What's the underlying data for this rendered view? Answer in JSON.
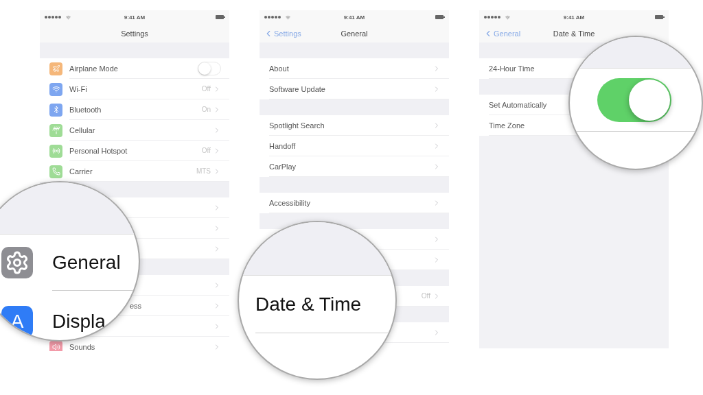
{
  "panels": [
    {
      "status": {
        "time": "9:41 AM"
      },
      "nav": {
        "title": "Settings"
      },
      "groups": [
        [
          {
            "label": "Airplane Mode",
            "kind": "toggle",
            "on": false
          },
          {
            "label": "Wi-Fi",
            "kind": "link",
            "value": "Off"
          },
          {
            "label": "Bluetooth",
            "kind": "link",
            "value": "On"
          },
          {
            "label": "Cellular",
            "kind": "link"
          },
          {
            "label": "Personal Hotspot",
            "kind": "link",
            "value": "Off"
          },
          {
            "label": "Carrier",
            "kind": "link",
            "value": "MTS"
          }
        ],
        [
          {
            "kind": "link"
          },
          {
            "kind": "link"
          },
          {
            "kind": "link"
          }
        ],
        [
          {
            "kind": "link"
          },
          {
            "kind": "link",
            "label": "ess",
            "clipped": true
          },
          {
            "kind": "link"
          },
          {
            "label": "Sounds",
            "kind": "link"
          }
        ]
      ]
    },
    {
      "status": {
        "time": "9:41 AM"
      },
      "nav": {
        "back": "Settings",
        "title": "General"
      },
      "groups": [
        [
          {
            "label": "About",
            "kind": "link"
          },
          {
            "label": "Software Update",
            "kind": "link"
          }
        ],
        [
          {
            "label": "Spotlight Search",
            "kind": "link"
          },
          {
            "label": "Handoff",
            "kind": "link"
          },
          {
            "label": "CarPlay",
            "kind": "link"
          }
        ],
        [
          {
            "label": "Accessibility",
            "kind": "link"
          }
        ],
        [
          {
            "kind": "link"
          },
          {
            "kind": "link"
          }
        ],
        [
          {
            "kind": "link",
            "value": "Off"
          }
        ],
        [
          {
            "kind": "link"
          }
        ]
      ]
    },
    {
      "status": {
        "time": "9:41 AM"
      },
      "nav": {
        "back": "General",
        "title": "Date & Time"
      },
      "groups": [
        [
          {
            "label": "24-Hour Time",
            "kind": "plain"
          }
        ],
        [
          {
            "label": "Set Automatically",
            "kind": "plain"
          },
          {
            "label": "Time Zone",
            "kind": "plain"
          }
        ]
      ]
    }
  ],
  "magnifiers": [
    {
      "kind": "rows",
      "rows": [
        {
          "label": "General"
        },
        {
          "label": "Displa",
          "icon_text": "A"
        }
      ]
    },
    {
      "kind": "row",
      "label": "Date & Time"
    },
    {
      "kind": "toggle",
      "on": true
    }
  ]
}
